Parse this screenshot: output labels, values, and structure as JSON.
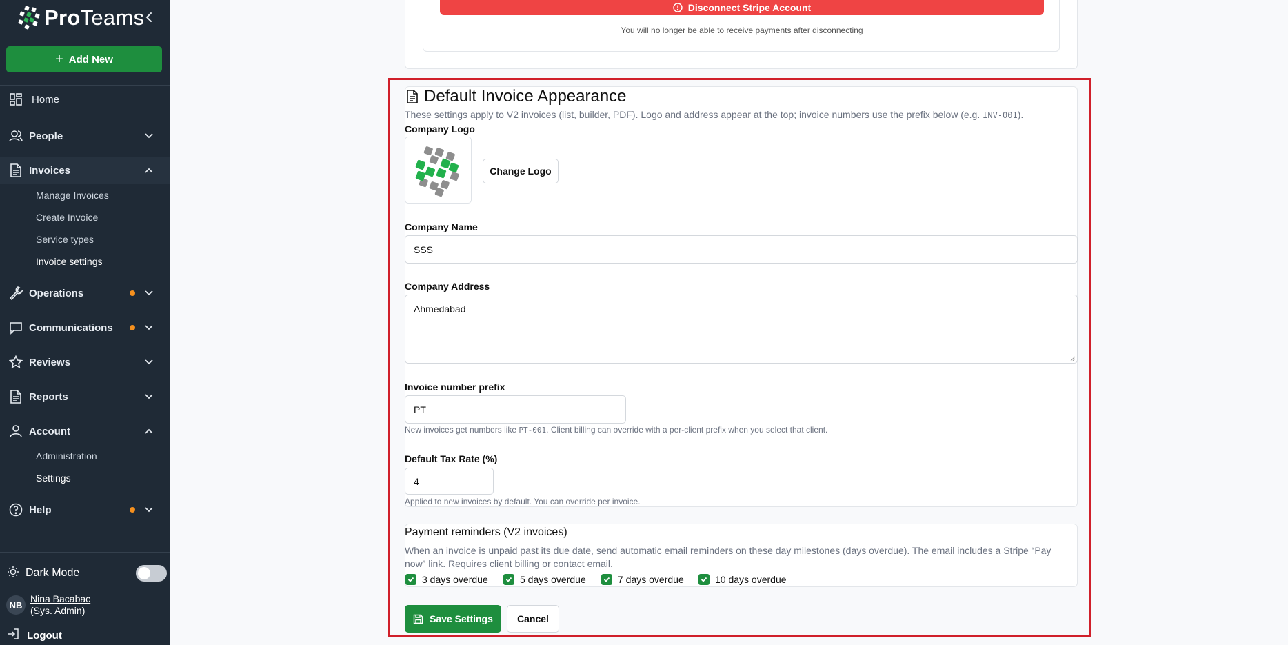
{
  "brand": {
    "name_bold": "Pro",
    "name_light": "Teams"
  },
  "sidebar": {
    "add_new_label": "Add New",
    "items": [
      {
        "label": "Home",
        "icon": "dashboard-icon"
      },
      {
        "label": "People",
        "icon": "people-icon"
      },
      {
        "label": "Invoices",
        "icon": "document-icon",
        "expanded": true,
        "children": [
          "Manage Invoices",
          "Create Invoice",
          "Service types",
          "Invoice settings"
        ]
      },
      {
        "label": "Operations",
        "icon": "wrench-icon",
        "badge": true
      },
      {
        "label": "Communications",
        "icon": "chat-icon",
        "badge": true
      },
      {
        "label": "Reviews",
        "icon": "star-icon"
      },
      {
        "label": "Reports",
        "icon": "report-icon"
      },
      {
        "label": "Account",
        "icon": "user-icon",
        "expanded": true,
        "children": [
          "Administration",
          "Settings"
        ]
      },
      {
        "label": "Help",
        "icon": "help-icon",
        "badge": true
      }
    ],
    "dark_mode_label": "Dark Mode",
    "user": {
      "initials": "NB",
      "name": "Nina Bacabac",
      "role": "(Sys. Admin)"
    },
    "logout_label": "Logout"
  },
  "stripe": {
    "disconnect_label": "Disconnect Stripe Account",
    "note": "You will no longer be able to receive payments after disconnecting"
  },
  "invoice_appearance": {
    "title": "Default Invoice Appearance",
    "description": "These settings apply to V2 invoices (list, builder, PDF). Logo and address appear at the top; invoice numbers use the prefix below (e.g. ",
    "description_example": "INV-001",
    "description_end": ").",
    "company_logo_label": "Company Logo",
    "change_logo_label": "Change Logo",
    "company_name_label": "Company Name",
    "company_name_value": "SSS",
    "company_address_label": "Company Address",
    "company_address_value": "Ahmedabad",
    "prefix_label": "Invoice number prefix",
    "prefix_value": "PT",
    "prefix_help_start": "New invoices get numbers like ",
    "prefix_help_example": "PT-001",
    "prefix_help_end": ". Client billing can override with a per-client prefix when you select that client.",
    "tax_label": "Default Tax Rate (%)",
    "tax_value": "4",
    "tax_help": "Applied to new invoices by default. You can override per invoice."
  },
  "reminders": {
    "title": "Payment reminders (V2 invoices)",
    "description": "When an invoice is unpaid past its due date, send automatic email reminders on these day milestones (days overdue). The email includes a Stripe “Pay now” link. Requires client billing or contact email.",
    "options": [
      {
        "label": "3 days overdue",
        "checked": true
      },
      {
        "label": "5 days overdue",
        "checked": true
      },
      {
        "label": "7 days overdue",
        "checked": true
      },
      {
        "label": "10 days overdue",
        "checked": true
      }
    ]
  },
  "actions": {
    "save_label": "Save Settings",
    "cancel_label": "Cancel"
  },
  "colors": {
    "sidebar_bg": "#1f2a36",
    "accent_green": "#1e8e3e",
    "danger_red": "#ef4444",
    "badge_orange": "#f5901e",
    "highlight": "#d0202a"
  }
}
